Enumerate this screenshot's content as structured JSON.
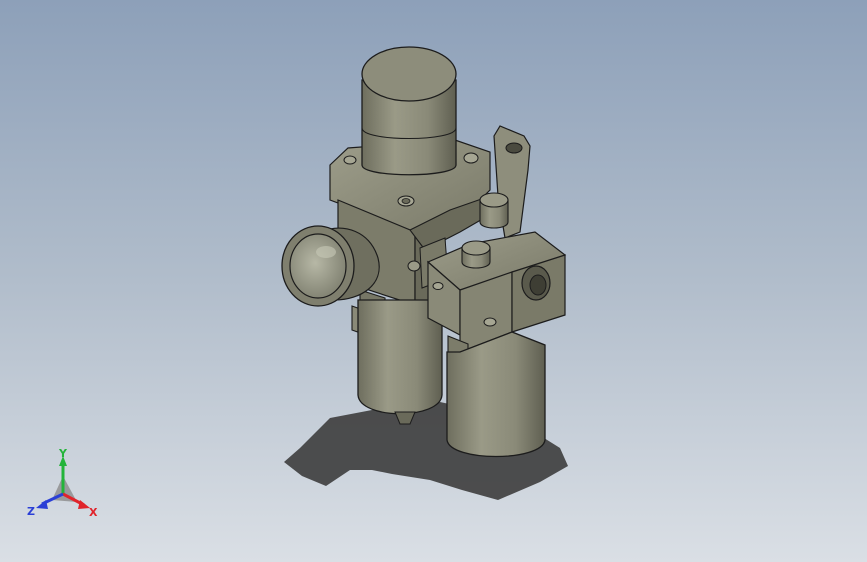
{
  "viewport": {
    "background_top": "#8da0b9",
    "background_bottom": "#dadfe5"
  },
  "model": {
    "body_color": "#8a8a78",
    "edge_color": "#1c1c1c",
    "shadow_color": "#3d3d3d"
  },
  "triad": {
    "x_label": "X",
    "y_label": "Y",
    "z_label": "Z",
    "x_color": "#e0242b",
    "y_color": "#23b43a",
    "z_color": "#2a3fd6"
  }
}
